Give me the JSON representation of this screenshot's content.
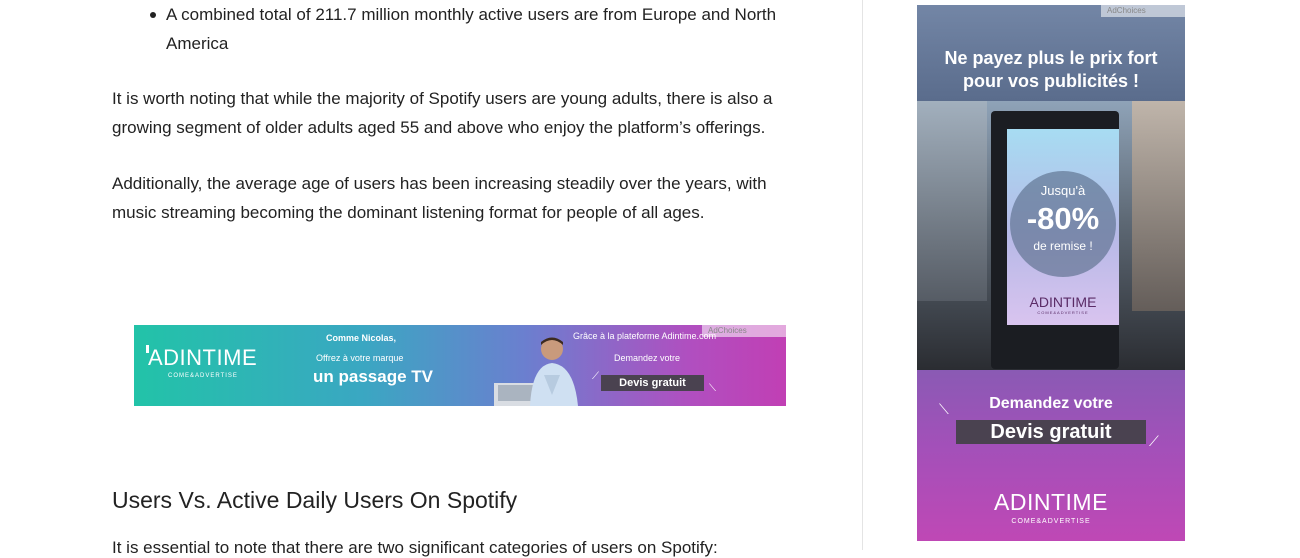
{
  "article": {
    "bullet_line_1": "A combined total of 211.7 million monthly active users are from Europe and North",
    "bullet_line_2": "America",
    "paragraph_1_line_1": "It is worth noting that while the majority of Spotify users are young adults, there is also a",
    "paragraph_1_line_2": "growing segment of older adults aged 55 and above who enjoy the platform’s offerings.",
    "paragraph_2_line_1": "Additionally, the average age of users has been increasing steadily over the years, with",
    "paragraph_2_line_2": "music streaming becoming the dominant listening format for people of all ages.",
    "heading": "Users Vs. Active Daily Users On Spotify",
    "cut_line": "It is essential to note that there are two significant categories of users on Spotify:"
  },
  "banner_ad": {
    "logo": "ADINTIME",
    "logo_sub": "COME&ADVERTISE",
    "line_1": "Comme Nicolas,",
    "line_2": "Offrez à votre marque",
    "line_3": "un passage TV",
    "line_4": "Grâce à la plateforme Adintime.com",
    "line_5": "Demandez votre",
    "cta": "Devis gratuit",
    "adchoices": "AdChoices"
  },
  "sidebar_ad": {
    "headline_1": "Ne payez plus le prix fort",
    "headline_2": "pour vos publicités !",
    "adchoices": "AdChoices",
    "screen_line_1": "Jusqu'à",
    "screen_line_2": "-80%",
    "screen_line_3": "de remise !",
    "screen_logo": "ADINTIME",
    "screen_logo_sub": "COME&ADVERTISE",
    "bottom_line": "Demandez votre",
    "cta": "Devis gratuit",
    "logo": "ADINTIME",
    "logo_sub": "COME&ADVERTISE"
  },
  "colors": {
    "text": "#222222",
    "divider": "#e4e4e4",
    "cta_bg": "#4a4250"
  }
}
